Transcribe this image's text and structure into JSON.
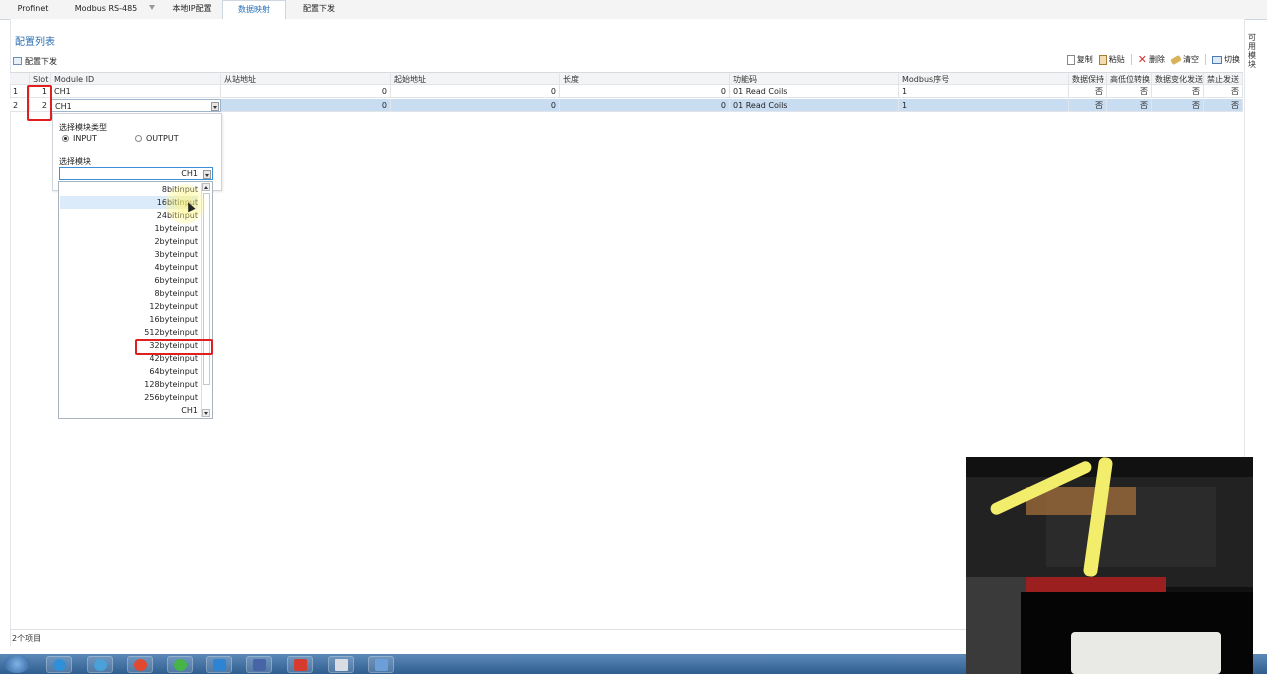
{
  "tabs": [
    "Profinet",
    "Modbus RS-485",
    "本地IP配置",
    "数据映射",
    "配置下发"
  ],
  "active_tab": "数据映射",
  "list_title": "配置列表",
  "deploy_label": "配置下发",
  "toolbar": {
    "copy": "复制",
    "paste": "粘贴",
    "delete": "删除",
    "clear": "清空",
    "switch": "切换"
  },
  "sidebar_text": "可\n用\n模\n块",
  "columns": [
    "Slot",
    "Module ID",
    "从站地址",
    "起始地址",
    "长度",
    "功能码",
    "Modbus序号",
    "数据保持",
    "高低位转换",
    "数据变化发送",
    "禁止发送"
  ],
  "rows": [
    {
      "idx": "1",
      "slot": "1",
      "module": "CH1",
      "slave": "0",
      "start": "0",
      "length": "0",
      "func": "01 Read Coils",
      "modbus": "1",
      "keep": "否",
      "swap": "否",
      "change": "否",
      "forbid": "否"
    },
    {
      "idx": "2",
      "slot": "2",
      "module": "CH1",
      "slave": "0",
      "start": "0",
      "length": "0",
      "func": "01 Read Coils",
      "modbus": "1",
      "keep": "否",
      "swap": "否",
      "change": "否",
      "forbid": "否"
    }
  ],
  "editor": {
    "type_label": "选择模块类型",
    "input_label": "INPUT",
    "output_label": "OUTPUT",
    "selected_type": "INPUT",
    "module_label": "选择模块",
    "module_value": "CH1"
  },
  "dropdown_items": [
    "8bitinput",
    "16bitinput",
    "24bitinput",
    "1byteinput",
    "2byteinput",
    "3byteinput",
    "4byteinput",
    "6byteinput",
    "8byteinput",
    "12byteinput",
    "16byteinput",
    "512byteinput",
    "32byteinput",
    "42byteinput",
    "64byteinput",
    "128byteinput",
    "256byteinput",
    "CH1"
  ],
  "hovered_item": "16bitinput",
  "highlighted_item": "32byteinput",
  "status_text": "2个项目"
}
